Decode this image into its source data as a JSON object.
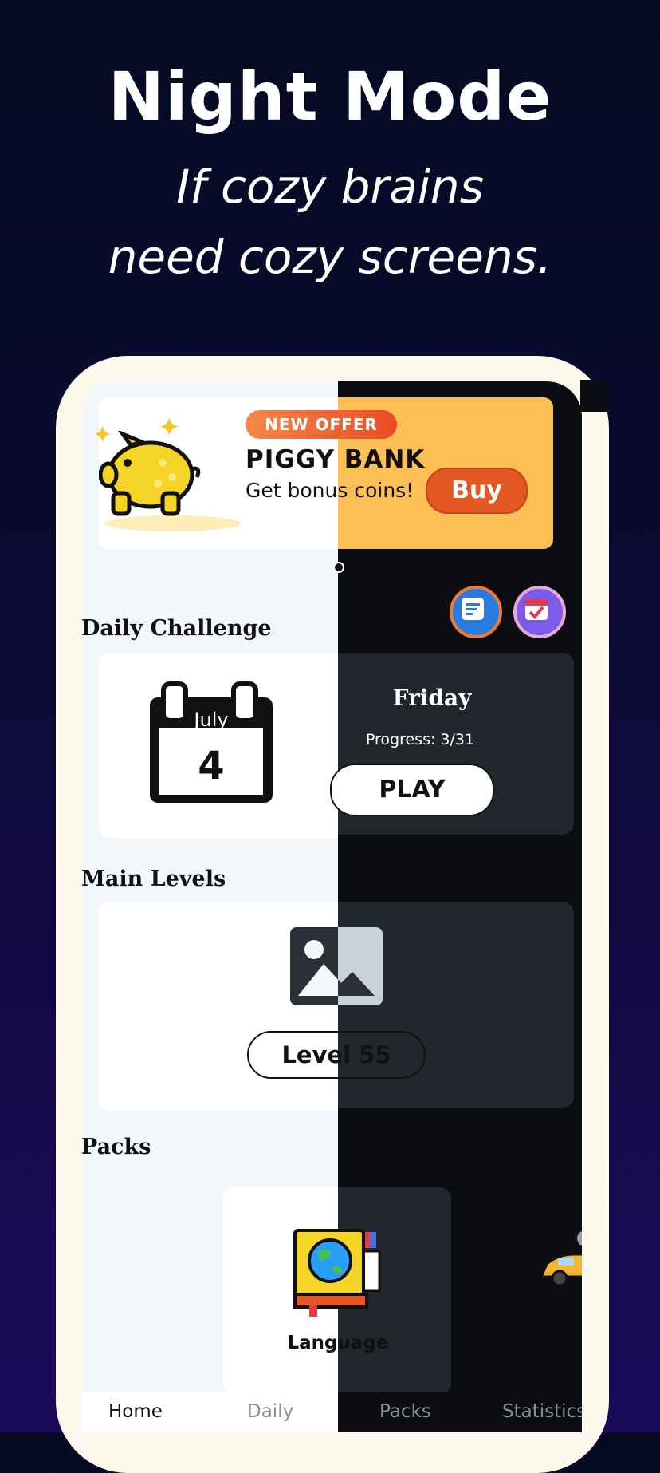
{
  "headline": {
    "title": "Night Mode",
    "tagline_line1": "If cozy brains",
    "tagline_line2": "need cozy screens."
  },
  "banner": {
    "badge": "NEW OFFER",
    "title": "PIGGY BANK",
    "subtitle": "Get bonus coins!",
    "buy_label": "Buy"
  },
  "daily_challenge": {
    "section_title": "Daily Challenge",
    "calendar_month": "July",
    "calendar_day": "4",
    "weekday": "Friday",
    "progress": "Progress: 3/31",
    "play_label": "PLAY"
  },
  "main_levels": {
    "section_title": "Main Levels",
    "level_label": "Level 55"
  },
  "packs": {
    "section_title": "Packs",
    "items": [
      {
        "label": "Language",
        "icon": "book-globe-icon"
      },
      {
        "label": "",
        "icon": "taxi-car-icon"
      }
    ]
  },
  "tabs": [
    {
      "label": "Home"
    },
    {
      "label": "Daily"
    },
    {
      "label": "Packs"
    },
    {
      "label": "Statistics"
    }
  ],
  "colors": {
    "accent_orange": "#e35823",
    "banner_yellow": "#fcbf55",
    "dark_surface": "#22262d",
    "dark_bg": "#0b0d12"
  }
}
